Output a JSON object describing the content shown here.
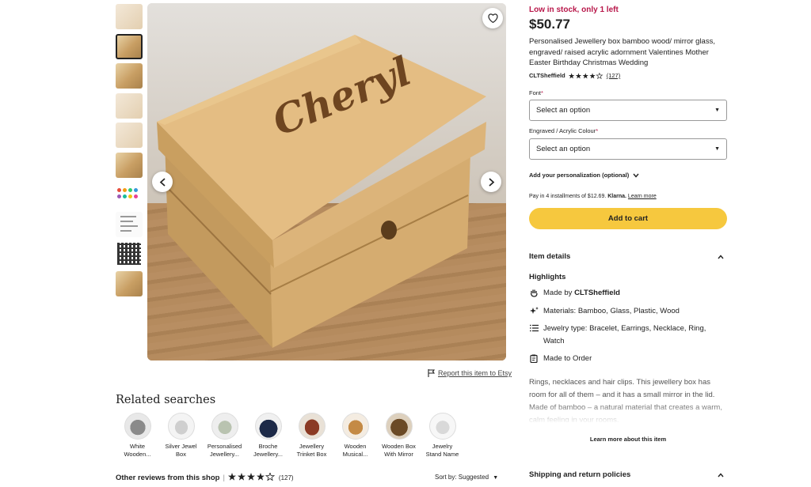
{
  "gallery": {
    "thumbnails": [
      {
        "name": "thumbnail-1"
      },
      {
        "name": "thumbnail-2"
      },
      {
        "name": "thumbnail-3"
      },
      {
        "name": "thumbnail-4"
      },
      {
        "name": "thumbnail-5"
      },
      {
        "name": "thumbnail-6"
      },
      {
        "name": "thumbnail-7"
      },
      {
        "name": "thumbnail-8"
      },
      {
        "name": "thumbnail-9"
      },
      {
        "name": "thumbnail-10"
      }
    ],
    "engraved_name": "Cheryl"
  },
  "report_link": "Report this item to Etsy",
  "related": {
    "title": "Related searches",
    "items": [
      {
        "line1": "White",
        "line2": "Wooden..."
      },
      {
        "line1": "Silver Jewel",
        "line2": "Box"
      },
      {
        "line1": "Personalised",
        "line2": "Jewellery..."
      },
      {
        "line1": "Broche",
        "line2": "Jewellery..."
      },
      {
        "line1": "Jewellery",
        "line2": "Trinket Box"
      },
      {
        "line1": "Wooden",
        "line2": "Musical..."
      },
      {
        "line1": "Wooden Box",
        "line2": "With Mirror"
      },
      {
        "line1": "Jewelry",
        "line2": "Stand Name"
      }
    ]
  },
  "other_reviews": {
    "label": "Other reviews from this shop",
    "count": "(127)",
    "sort": "Sort by: Suggested"
  },
  "product": {
    "stock": "Low in stock, only 1 left",
    "price": "$50.77",
    "title": "Personalised Jewellery box bamboo wood/ mirror glass, engraved/ raised acrylic adornment Valentines Mother Easter Birthday Christmas Wedding",
    "shop_name": "CLTSheffield",
    "review_count": "(127)",
    "rating": 4.5,
    "font_label": "Font",
    "font_select": "Select an option",
    "colour_label": "Engraved / Acrylic Colour",
    "colour_select": "Select an option",
    "personalization": "Add your personalization (optional)",
    "installments": "Pay in 4 installments of $12.69.",
    "klarna": "Klarna.",
    "learn_more": "Learn more",
    "add_to_cart": "Add to cart"
  },
  "item_details": {
    "heading": "Item details",
    "highlights_title": "Highlights",
    "made_by_prefix": "Made by ",
    "made_by_shop": "CLTSheffield",
    "materials": "Materials: Bamboo, Glass, Plastic, Wood",
    "jewelry_type": "Jewelry type: Bracelet, Earrings, Necklace, Ring, Watch",
    "made_to_order": "Made to Order",
    "description": "Rings, necklaces and hair clips. This jewellery box has room for all of them – and it has a small mirror in the lid. Made of bamboo – a natural material that creates a warm, calm feeling in your rooms.",
    "learn_more_item": "Learn more about this item"
  },
  "shipping": {
    "heading": "Shipping and return policies"
  },
  "colors": {
    "cart": "#f6c83e",
    "stock": "#b8174a"
  }
}
